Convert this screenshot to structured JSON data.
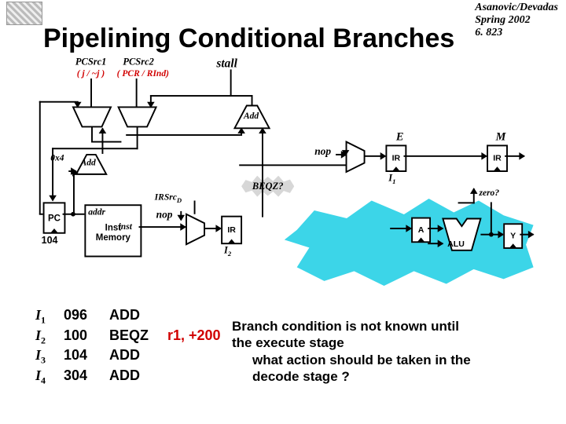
{
  "header": {
    "line1": "Asanovic/Devadas",
    "line2": "Spring 2002",
    "line3": "6. 823"
  },
  "title": "Pipelining Conditional Branches",
  "diagram": {
    "pcsrc1": "PCSrc1",
    "pcsrc1_sub": "( j / ~j )",
    "pcsrc2": "PCSrc2",
    "pcsrc2_sub": "( PCR / RInd)",
    "stall": "stall",
    "add1": "Add",
    "add2": "Add",
    "const": "0x4",
    "nop1": "nop",
    "nop2": "nop",
    "beqz": "BEQZ?",
    "irsrcD": "IRSrc",
    "irsrcD_sub": "D",
    "pc": "PC",
    "pc_val": "104",
    "addr": "addr",
    "inst": "inst",
    "imem": "Inst\nMemory",
    "ir_d": "IR",
    "i2": "I",
    "i2_sub": "2",
    "e": "E",
    "m": "M",
    "ir_e": "IR",
    "ir_m": "IR",
    "i1": "I",
    "i1_sub": "1",
    "zero": "zero?",
    "a": "A",
    "alu": "ALU",
    "y": "Y"
  },
  "instructions": [
    {
      "idx": "I",
      "sub": "1",
      "addr": "096",
      "mnem": "ADD",
      "ops": ""
    },
    {
      "idx": "I",
      "sub": "2",
      "addr": "100",
      "mnem": "BEQZ",
      "ops": "r1, +200",
      "ops_red": true
    },
    {
      "idx": "I",
      "sub": "3",
      "addr": "104",
      "mnem": "ADD",
      "ops": ""
    },
    {
      "idx": "I",
      "sub": "4",
      "addr": "304",
      "mnem": "ADD",
      "ops": ""
    }
  ],
  "explain": {
    "line1": "Branch condition is not known until",
    "line2": "the execute stage",
    "line3": "what action should be taken in the",
    "line4": "decode stage ?"
  }
}
